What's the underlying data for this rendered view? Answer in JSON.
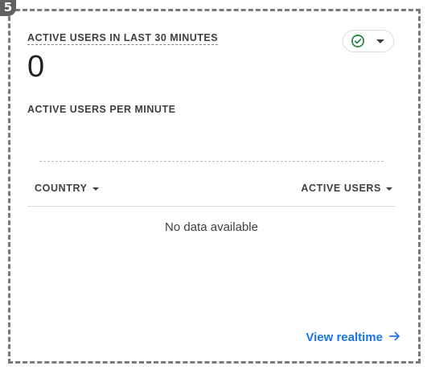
{
  "annotation": {
    "step_number": "5"
  },
  "card": {
    "title": "ACTIVE USERS IN LAST 30 MINUTES",
    "value": "0",
    "status": {
      "icon": "check-circle-icon",
      "color": "#188038"
    },
    "subtitle": "ACTIVE USERS PER MINUTE",
    "table": {
      "columns": [
        "COUNTRY",
        "ACTIVE USERS"
      ],
      "empty_message": "No data available"
    },
    "footer_link": "View realtime"
  },
  "colors": {
    "accent": "#1a73e8",
    "success": "#188038",
    "text": "#3c4043"
  }
}
